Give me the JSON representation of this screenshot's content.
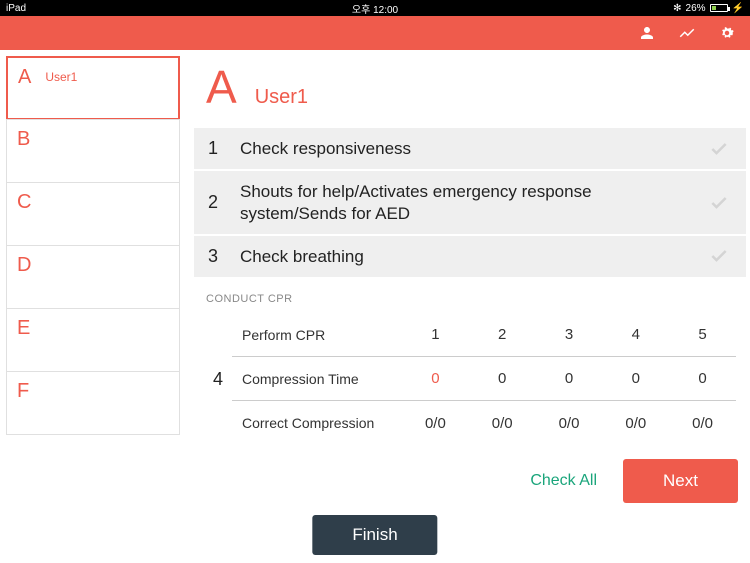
{
  "status": {
    "device": "iPad",
    "time": "오후 12:00",
    "bt": "✻",
    "battery": "26%"
  },
  "header": {
    "icons": [
      "user",
      "chart",
      "gear"
    ]
  },
  "sidebar": {
    "items": [
      {
        "letter": "A",
        "name": "User1",
        "selected": true
      },
      {
        "letter": "B",
        "name": "",
        "selected": false
      },
      {
        "letter": "C",
        "name": "",
        "selected": false
      },
      {
        "letter": "D",
        "name": "",
        "selected": false
      },
      {
        "letter": "E",
        "name": "",
        "selected": false
      },
      {
        "letter": "F",
        "name": "",
        "selected": false
      }
    ]
  },
  "content": {
    "letter": "A",
    "name": "User1",
    "steps": [
      {
        "num": "1",
        "text": "Check responsiveness"
      },
      {
        "num": "2",
        "text": "Shouts for help/Activates emergency response system/Sends for AED"
      },
      {
        "num": "3",
        "text": "Check breathing"
      }
    ],
    "section_label": "CONDUCT CPR",
    "cpr_num": "4",
    "cpr": {
      "header": {
        "label": "Perform CPR",
        "cols": [
          "1",
          "2",
          "3",
          "4",
          "5"
        ]
      },
      "rows": [
        {
          "label": "Compression Time",
          "cells": [
            "0",
            "0",
            "0",
            "0",
            "0"
          ],
          "hl_index": 0
        },
        {
          "label": "Correct Compression",
          "cells": [
            "0/0",
            "0/0",
            "0/0",
            "0/0",
            "0/0"
          ],
          "hl_index": -1
        }
      ]
    }
  },
  "actions": {
    "check_all": "Check All",
    "next": "Next",
    "finish": "Finish"
  }
}
